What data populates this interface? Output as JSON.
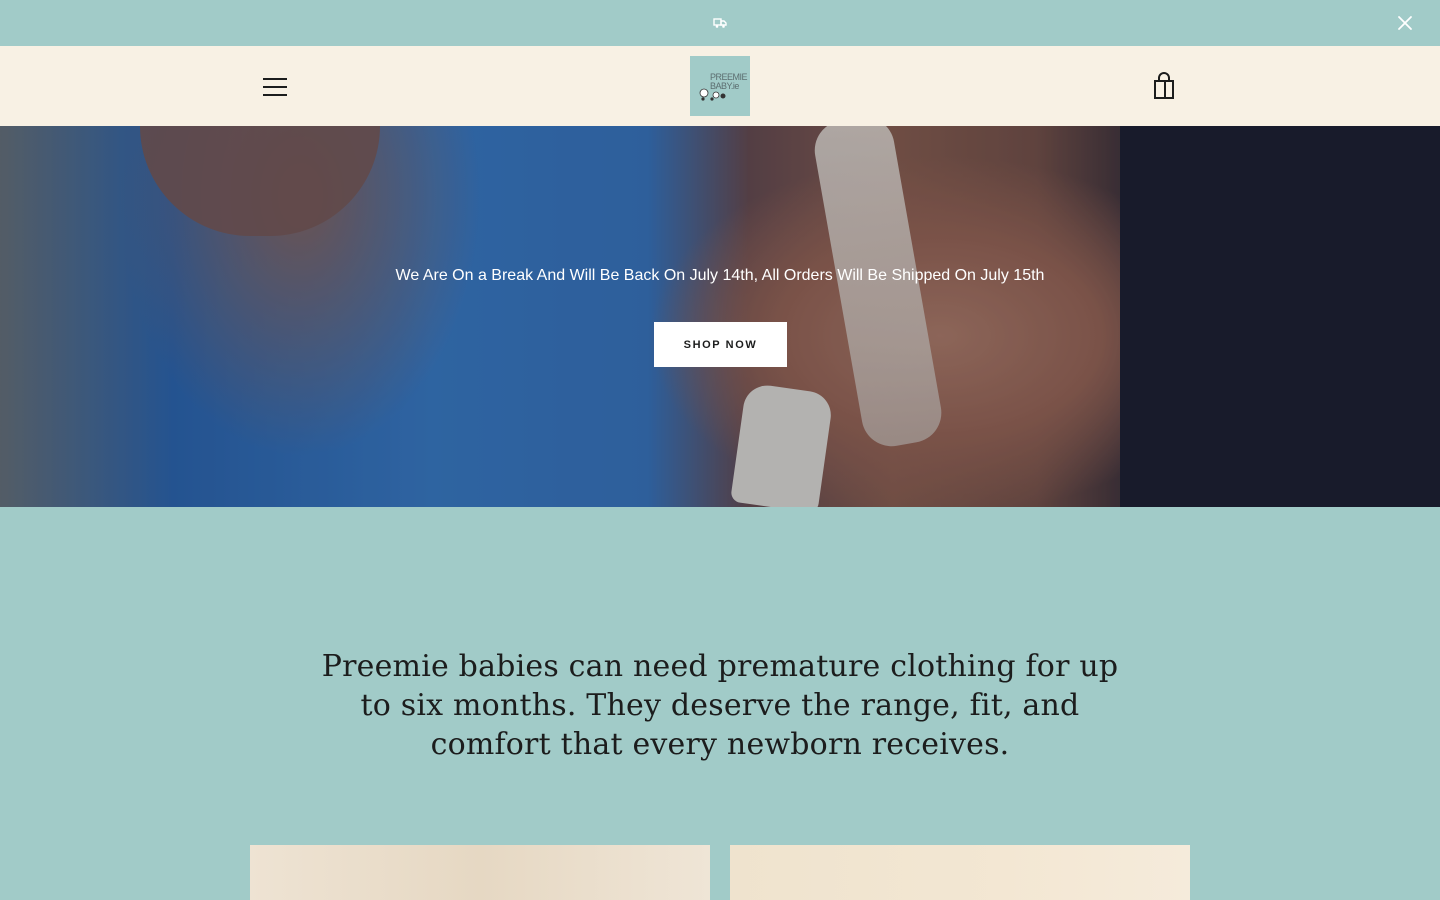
{
  "announcement": {
    "icon": "truck-icon",
    "close_icon": "close-icon"
  },
  "header": {
    "menu_icon": "hamburger-icon",
    "logo_text": "PREEMIE\nBABY.ie",
    "cart_icon": "shopping-bag-icon"
  },
  "hero": {
    "message": "We Are On a Break And Will Be Back On July 14th, All Orders Will Be Shipped On July 15th",
    "button_label": "SHOP NOW"
  },
  "intro": {
    "text": "Preemie babies can need premature clothing for up to six months. They deserve the range, fit, and comfort that every newborn receives."
  },
  "colors": {
    "background": "#a1cbc8",
    "header": "#f8f1e4",
    "text": "#1c1d1d",
    "button": "#ffffff"
  }
}
